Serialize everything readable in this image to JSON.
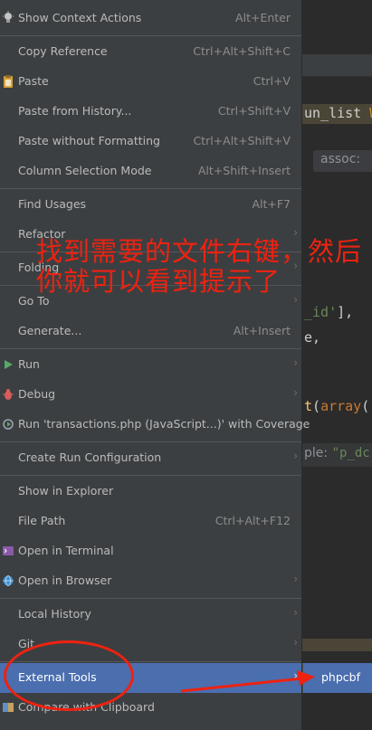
{
  "editor": {
    "code_line_1_text": "un_list ",
    "code_line_1_accent": "W",
    "hint_assoc": "assoc:",
    "code_line_2_str": "_id'",
    "code_line_2_rest": "],",
    "code_line_3": "e,",
    "code_line_4_fn": "t",
    "code_line_4_paren": "(",
    "code_line_4_kw": "array",
    "code_line_4_end": "(",
    "hint_p_label": "ple:",
    "hint_p_value": "\"p_dc"
  },
  "menu": {
    "items": [
      {
        "label": "Show Context Actions",
        "shortcut": "Alt+Enter",
        "icon": "lightbulb-icon"
      },
      {
        "label": "Copy Reference",
        "shortcut": "Ctrl+Alt+Shift+C"
      },
      {
        "label": "Paste",
        "shortcut": "Ctrl+V",
        "icon": "clipboard-icon"
      },
      {
        "label": "Paste from History...",
        "shortcut": "Ctrl+Shift+V"
      },
      {
        "label": "Paste without Formatting",
        "shortcut": "Ctrl+Alt+Shift+V"
      },
      {
        "label": "Column Selection Mode",
        "shortcut": "Alt+Shift+Insert"
      },
      {
        "label": "Find Usages",
        "shortcut": "Alt+F7"
      },
      {
        "label": "Refactor",
        "submenu": true
      },
      {
        "label": "Folding",
        "submenu": true
      },
      {
        "label": "Go To",
        "submenu": true
      },
      {
        "label": "Generate...",
        "shortcut": "Alt+Insert"
      },
      {
        "label": "Run",
        "icon": "run-icon",
        "submenu": true
      },
      {
        "label": "Debug",
        "icon": "debug-icon",
        "submenu": true
      },
      {
        "label": "Run 'transactions.php (JavaScript...)' with Coverage",
        "icon": "coverage-icon"
      },
      {
        "label": "Create Run Configuration",
        "submenu": true
      },
      {
        "label": "Show in Explorer"
      },
      {
        "label": "File Path",
        "shortcut": "Ctrl+Alt+F12"
      },
      {
        "label": "Open in Terminal",
        "icon": "terminal-icon"
      },
      {
        "label": "Open in Browser",
        "icon": "globe-icon",
        "submenu": true
      },
      {
        "label": "Local History",
        "submenu": true
      },
      {
        "label": "Git",
        "submenu": true
      },
      {
        "label": "External Tools",
        "submenu": true,
        "selected": true
      },
      {
        "label": "Compare with Clipboard",
        "icon": "compare-icon"
      }
    ]
  },
  "submenu": {
    "items": [
      {
        "label": "phpcbf"
      }
    ]
  },
  "annotation": {
    "text": "找到需要的文件右键，然后你就可以看到提示了",
    "color": "#ee2211"
  },
  "colors": {
    "menu_bg": "#3c3f41",
    "selection": "#4b6eaf",
    "annotation": "#ee2211"
  }
}
